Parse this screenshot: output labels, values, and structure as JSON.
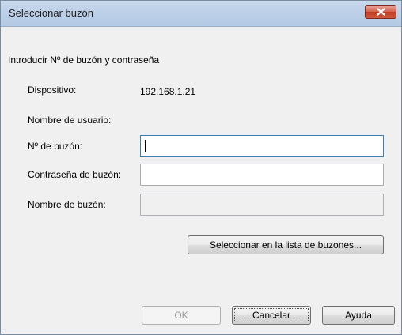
{
  "window": {
    "title": "Seleccionar buzón"
  },
  "form": {
    "heading": "Introducir Nº de buzón y contraseña",
    "device_label": "Dispositivo:",
    "device_value": "192.168.1.21",
    "username_label": "Nombre de usuario:",
    "mailbox_number_label": "Nº de buzón:",
    "mailbox_number_value": "",
    "mailbox_password_label": "Contraseña de buzón:",
    "mailbox_password_value": "",
    "mailbox_name_label": "Nombre de buzón:",
    "mailbox_name_value": ""
  },
  "buttons": {
    "select_from_list": "Seleccionar en la lista de buzones...",
    "ok": "OK",
    "cancel": "Cancelar",
    "help": "Ayuda"
  },
  "icons": {
    "close": "close-icon"
  },
  "colors": {
    "titlebar": "#bcd0e8",
    "close_button": "#c13a23",
    "focus_border": "#3c7fb1"
  }
}
